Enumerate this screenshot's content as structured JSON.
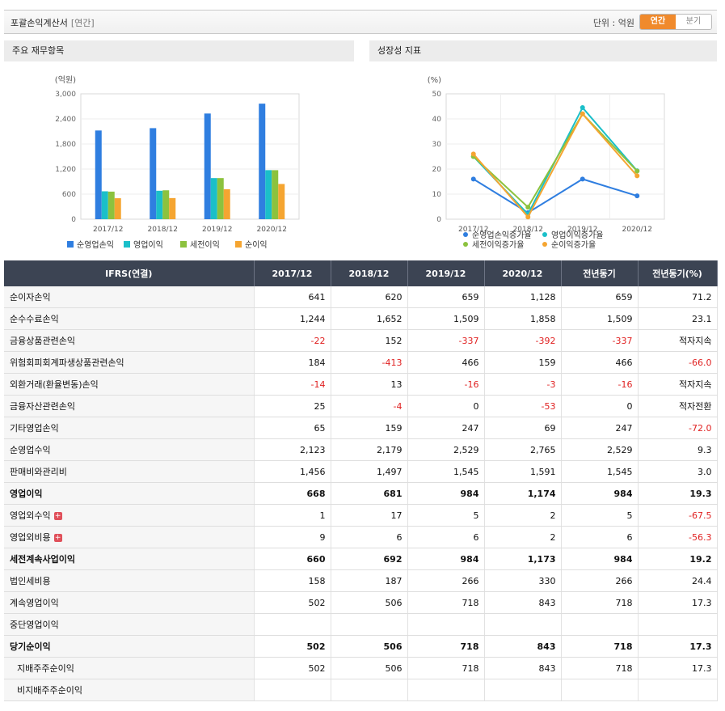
{
  "header": {
    "title": "포괄손익계산서",
    "period_tag": "[연간]",
    "unit_label": "단위 : 억원",
    "toggle": [
      "연간",
      "분기"
    ]
  },
  "chart_panels": {
    "left_title": "주요 재무항목",
    "right_title": "성장성 지표"
  },
  "chart_data": [
    {
      "type": "bar",
      "ylabel": "(억원)",
      "ylim": [
        0,
        3000
      ],
      "yticks": [
        "3,000",
        "2,400",
        "1,800",
        "1,200",
        "600",
        "0"
      ],
      "categories": [
        "2017/12",
        "2018/12",
        "2019/12",
        "2020/12"
      ],
      "series": [
        {
          "name": "순영업손익",
          "color": "#2f7ee0",
          "values": [
            2123,
            2179,
            2529,
            2765
          ]
        },
        {
          "name": "영업이익",
          "color": "#1bbfc9",
          "values": [
            668,
            681,
            984,
            1174
          ]
        },
        {
          "name": "세전이익",
          "color": "#8cc23e",
          "values": [
            660,
            692,
            984,
            1173
          ]
        },
        {
          "name": "순이익",
          "color": "#f5a531",
          "values": [
            502,
            506,
            718,
            843
          ]
        }
      ]
    },
    {
      "type": "line",
      "ylabel": "(%)",
      "ylim": [
        0,
        50
      ],
      "yticks": [
        "50",
        "40",
        "30",
        "20",
        "10",
        "0"
      ],
      "categories": [
        "2017/12",
        "2018/12",
        "2019/12",
        "2020/12"
      ],
      "series": [
        {
          "name": "순영업손익증가율",
          "color": "#2f7ee0",
          "values": [
            16,
            2.6,
            16,
            9.3
          ]
        },
        {
          "name": "영업이익증가율",
          "color": "#1bbfc9",
          "values": [
            25,
            2,
            44.5,
            19.3
          ]
        },
        {
          "name": "세전이익증가율",
          "color": "#8cc23e",
          "values": [
            25,
            4.8,
            42,
            19.2
          ]
        },
        {
          "name": "순이익증가율",
          "color": "#f5a531",
          "values": [
            26,
            0.9,
            42,
            17.3
          ]
        }
      ]
    }
  ],
  "table": {
    "headers": [
      "IFRS(연결)",
      "2017/12",
      "2018/12",
      "2019/12",
      "2020/12",
      "전년동기",
      "전년동기(%)"
    ],
    "rows": [
      {
        "label": "순이자손익",
        "cells": [
          "641",
          "620",
          "659",
          "1,128",
          "659",
          "71.2"
        ]
      },
      {
        "label": "순수수료손익",
        "cells": [
          "1,244",
          "1,652",
          "1,509",
          "1,858",
          "1,509",
          "23.1"
        ]
      },
      {
        "label": "금융상품관련손익",
        "cells": [
          "-22",
          "152",
          "-337",
          "-392",
          "-337",
          "적자지속"
        ]
      },
      {
        "label": "위험회피회계파생상품관련손익",
        "cells": [
          "184",
          "-413",
          "466",
          "159",
          "466",
          "-66.0"
        ]
      },
      {
        "label": "외환거래(환율변동)손익",
        "cells": [
          "-14",
          "13",
          "-16",
          "-3",
          "-16",
          "적자지속"
        ]
      },
      {
        "label": "금융자산관련손익",
        "cells": [
          "25",
          "-4",
          "0",
          "-53",
          "0",
          "적자전환"
        ]
      },
      {
        "label": "기타영업손익",
        "cells": [
          "65",
          "159",
          "247",
          "69",
          "247",
          "-72.0"
        ]
      },
      {
        "label": "순영업수익",
        "cells": [
          "2,123",
          "2,179",
          "2,529",
          "2,765",
          "2,529",
          "9.3"
        ]
      },
      {
        "label": "판매비와관리비",
        "cells": [
          "1,456",
          "1,497",
          "1,545",
          "1,591",
          "1,545",
          "3.0"
        ]
      },
      {
        "label": "영업이익",
        "bold": true,
        "cells": [
          "668",
          "681",
          "984",
          "1,174",
          "984",
          "19.3"
        ]
      },
      {
        "label": "영업외수익",
        "plus": true,
        "cells": [
          "1",
          "17",
          "5",
          "2",
          "5",
          "-67.5"
        ]
      },
      {
        "label": "영업외비용",
        "plus": true,
        "cells": [
          "9",
          "6",
          "6",
          "2",
          "6",
          "-56.3"
        ]
      },
      {
        "label": "세전계속사업이익",
        "bold": true,
        "cells": [
          "660",
          "692",
          "984",
          "1,173",
          "984",
          "19.2"
        ]
      },
      {
        "label": "법인세비용",
        "cells": [
          "158",
          "187",
          "266",
          "330",
          "266",
          "24.4"
        ]
      },
      {
        "label": "계속영업이익",
        "cells": [
          "502",
          "506",
          "718",
          "843",
          "718",
          "17.3"
        ]
      },
      {
        "label": "중단영업이익",
        "cells": [
          "",
          "",
          "",
          "",
          "",
          ""
        ]
      },
      {
        "label": "당기순이익",
        "bold": true,
        "cells": [
          "502",
          "506",
          "718",
          "843",
          "718",
          "17.3"
        ]
      },
      {
        "label": "지배주주순이익",
        "indent": true,
        "cells": [
          "502",
          "506",
          "718",
          "843",
          "718",
          "17.3"
        ]
      },
      {
        "label": "비지배주주순이익",
        "indent": true,
        "cells": [
          "",
          "",
          "",
          "",
          "",
          ""
        ]
      }
    ]
  }
}
